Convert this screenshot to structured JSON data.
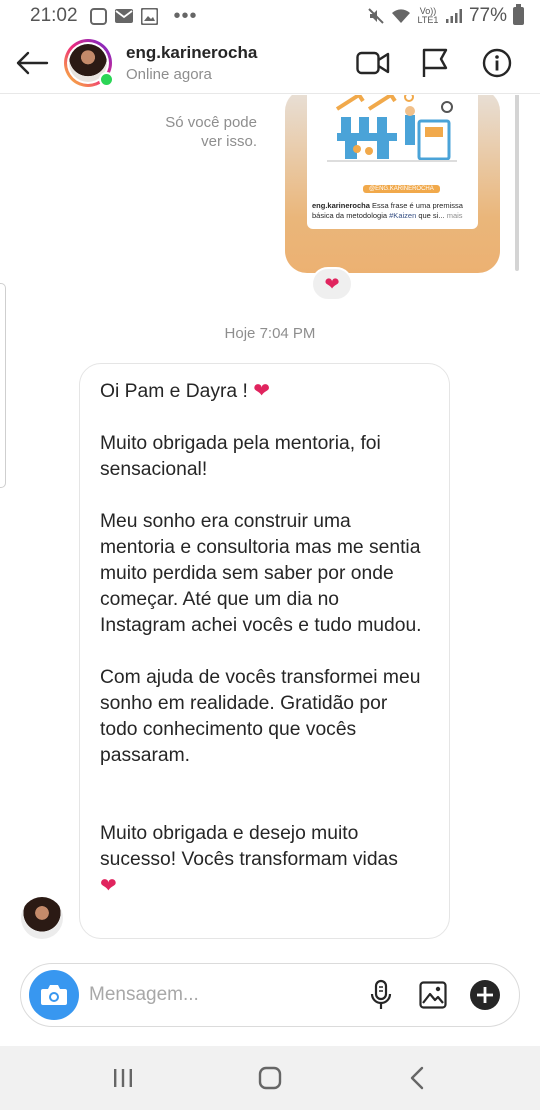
{
  "status_bar": {
    "time": "21:02",
    "network_label": "Vo)) LTE1",
    "battery": "77%",
    "overflow": "•••"
  },
  "header": {
    "username": "eng.karinerocha",
    "status": "Online agora"
  },
  "story": {
    "only_you_line1": "Só você pode",
    "only_you_line2": "ver isso.",
    "brand_tag": "@ENG.KARINEROCHA",
    "caption_user": "eng.karinerocha",
    "caption_text": " Essa frase é uma premissa básica da metodologia ",
    "caption_hashtag": "#Kaizen",
    "caption_tail": " que si...",
    "caption_more": " mais",
    "reaction": "❤"
  },
  "timestamp": "Hoje 7:04 PM",
  "message": {
    "greeting": "Oi Pam e Dayra ! ",
    "heart": "❤",
    "p1": "Muito obrigada pela mentoria, foi sensacional!",
    "p2": "Meu sonho era construir uma mentoria e consultoria mas me sentia muito perdida sem saber por onde começar. Até que um dia no Instagram achei vocês e tudo mudou.",
    "p3": "Com ajuda de vocês transformei meu sonho em realidade. Gratidão por todo conhecimento que vocês passaram.",
    "p4": "Muito obrigada e desejo muito sucesso! Vocês transformam vidas"
  },
  "composer": {
    "placeholder": "Mensagem..."
  },
  "icons": {
    "back": "arrow-left-icon",
    "video": "video-camera-icon",
    "flag": "flag-icon",
    "info": "info-icon",
    "camera": "camera-icon",
    "mic": "microphone-icon",
    "gallery": "gallery-icon",
    "plus": "plus-circle-icon",
    "nav_recent": "recent-apps-icon",
    "nav_home": "home-icon",
    "nav_back": "nav-back-icon"
  },
  "colors": {
    "accent_blue": "#3897f0",
    "online_green": "#2bd556",
    "heart_red": "#e0245e",
    "story_orange": "#ecb172"
  }
}
